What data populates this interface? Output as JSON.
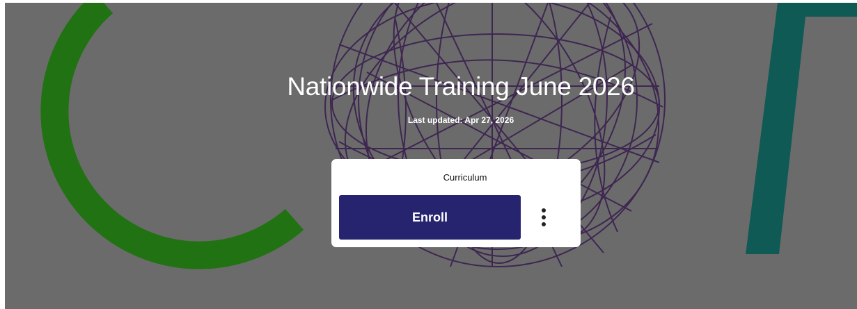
{
  "hero": {
    "title": "Nationwide Training June 2026",
    "last_updated": "Last updated: Apr 27, 2026",
    "colors": {
      "background": "#6b6b6b",
      "green_arc": "#217212",
      "purple_scribble": "#3a1f4f",
      "teal_letter": "#0f5a55"
    }
  },
  "card": {
    "label": "Curriculum",
    "enroll_label": "Enroll",
    "more_icon": "vertical-ellipsis-icon",
    "colors": {
      "button": "#26236f"
    }
  }
}
